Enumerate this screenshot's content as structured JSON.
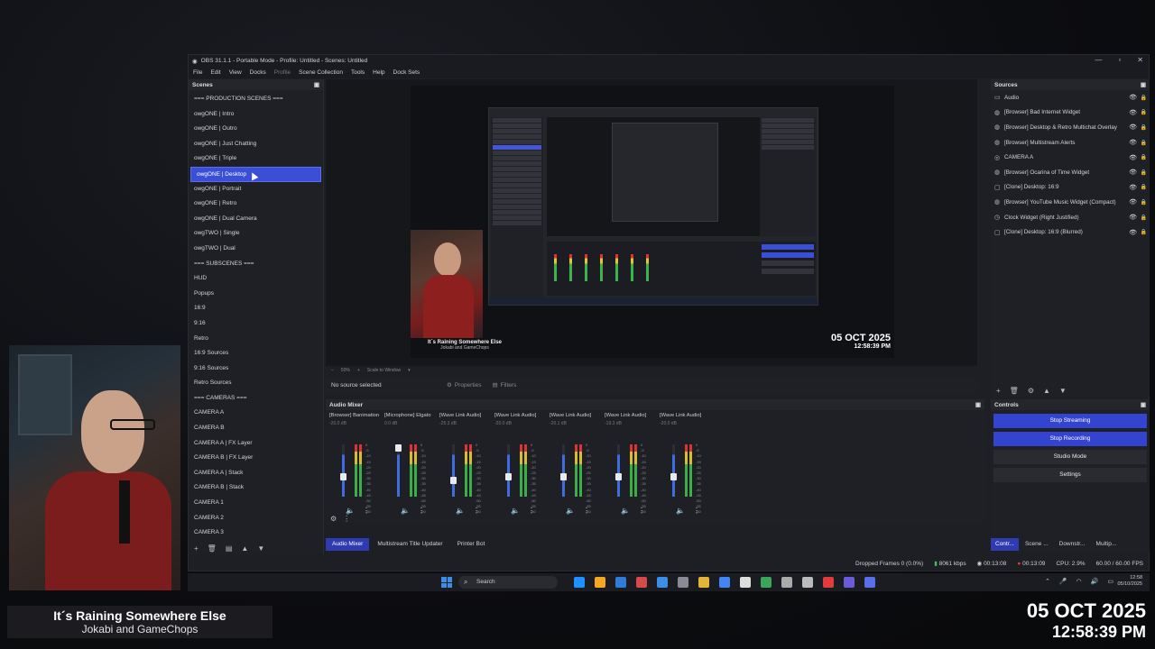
{
  "window": {
    "title": "OBS 31.1.1 - Portable Mode - Profile: Untitled - Scenes: Untitled",
    "minimize": "—",
    "maximize": "▫",
    "close": "✕"
  },
  "menu": [
    "File",
    "Edit",
    "View",
    "Docks",
    "Profile",
    "Scene Collection",
    "Tools",
    "Help",
    "Dock Sets"
  ],
  "scenes": {
    "title": "Scenes",
    "items": [
      "=== PRODUCTION SCENES ===",
      "owgONE | Intro",
      "owgONE | Outro",
      "owgONE | Just Chatting",
      "owgONE | Triple",
      "owgONE | Desktop",
      "owgONE | Portrait",
      "owgONE | Retro",
      "owgONE | Dual Camera",
      "owgTWO | Single",
      "owgTWO | Dual",
      "=== SUBSCENES ===",
      "HUD",
      "Popups",
      "16:9",
      "9:16",
      "Retro",
      "16:9 Sources",
      "9:16 Sources",
      "Retro Sources",
      "=== CAMERAS ===",
      "CAMERA A",
      "CAMERA B",
      "CAMERA A | FX Layer",
      "CAMERA B | FX Layer",
      "CAMERA A | Stack",
      "CAMERA B | Stack",
      "CAMERA 1",
      "CAMERA 2",
      "CAMERA 3"
    ],
    "selected_index": 5
  },
  "preview": {
    "song_title": "It´s Raining Somewhere Else",
    "song_artist": "Jokabi and GameChops",
    "date": "05 OCT 2025",
    "time": "12:58:39 PM",
    "zoom": "50%",
    "scale_mode": "Scale to Window"
  },
  "context": {
    "selection": "No source selected",
    "properties": "Properties",
    "filters": "Filters"
  },
  "mixer": {
    "title": "Audio Mixer",
    "channels": [
      {
        "name": "[Browser] Banimation",
        "db": "-20.0 dB"
      },
      {
        "name": "[Microphone] Elgato",
        "db": "0.0 dB"
      },
      {
        "name": "[Wave Link Audio]",
        "db": "-25.3 dB"
      },
      {
        "name": "[Wave Link Audio]",
        "db": "-20.0 dB"
      },
      {
        "name": "[Wave Link Audio]",
        "db": "-20.1 dB"
      },
      {
        "name": "[Wave Link Audio]",
        "db": "-19.3 dB"
      },
      {
        "name": "[Wave Link Audio]",
        "db": "-20.0 dB"
      }
    ],
    "scale": [
      "0",
      "-5",
      "-10",
      "-15",
      "-20",
      "-25",
      "-30",
      "-35",
      "-40",
      "-45",
      "-50",
      "-55",
      "-60"
    ]
  },
  "dock_tabs": [
    "Audio Mixer",
    "Multistream Title Updater",
    "Printer Bot"
  ],
  "sources": {
    "title": "Sources",
    "items": [
      {
        "label": "Audio",
        "icon": "folder-icon"
      },
      {
        "label": "[Browser] Bad Internet Widget",
        "icon": "globe-icon"
      },
      {
        "label": "[Browser] Desktop & Retro Multichat Overlay",
        "icon": "globe-icon"
      },
      {
        "label": "[Browser] Multistream Alerts",
        "icon": "globe-icon"
      },
      {
        "label": "CAMERA A",
        "icon": "camera-icon"
      },
      {
        "label": "[Browser] Ocarina of Time Widget",
        "icon": "globe-icon"
      },
      {
        "label": "[Clone] Desktop: 16:9",
        "icon": "clone-icon"
      },
      {
        "label": "[Browser] YouTube Music Widget (Compact)",
        "icon": "globe-icon"
      },
      {
        "label": "Clock Widget (Right Justified)",
        "icon": "clock-icon"
      },
      {
        "label": "[Clone] Desktop: 16:9 (Blurred)",
        "icon": "clone-icon"
      }
    ]
  },
  "controls": {
    "title": "Controls",
    "buttons": [
      "Stop Streaming",
      "Stop Recording",
      "Studio Mode",
      "Settings"
    ]
  },
  "right_tabs": [
    "Contr...",
    "Scene ...",
    "Downstr...",
    "Multip..."
  ],
  "status": {
    "dropped": "Dropped Frames 0 (0.0%)",
    "bitrate": "8061 kbps",
    "stream_time": "00:13:08",
    "rec_time": "00:13:09",
    "cpu": "CPU: 2.9%",
    "fps": "60.00 / 60.00 FPS"
  },
  "taskbar": {
    "search": "Search",
    "clock_time": "12:58",
    "clock_date": "05/10/2025",
    "icon_colors": [
      "#1e90ff",
      "#f5a623",
      "#2f7bd8",
      "#d84a4a",
      "#3a8ee8",
      "#8a8a96",
      "#e4b43a",
      "#4285f4",
      "#dddddd",
      "#3aa65a",
      "#aaaaaa",
      "#bbbbbb",
      "#e23b3b",
      "#6b5bd8",
      "#5b6ee8"
    ]
  },
  "overlay": {
    "song_title": "It´s Raining Somewhere Else",
    "song_artist": "Jokabi and GameChops",
    "date": "05 OCT 2025",
    "time": "12:58:39 PM"
  }
}
